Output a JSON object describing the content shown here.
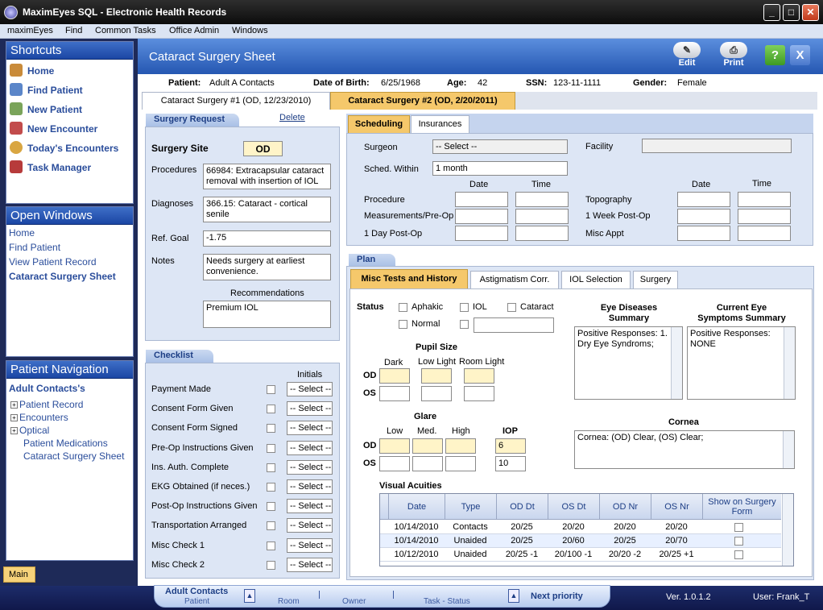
{
  "window": {
    "title": "MaximEyes SQL - Electronic Health Records"
  },
  "menu": [
    "maximEyes",
    "Find",
    "Common Tasks",
    "Office Admin",
    "Windows"
  ],
  "shortcuts": {
    "title": "Shortcuts",
    "items": [
      {
        "label": "Home",
        "icon": "home-icon"
      },
      {
        "label": "Find Patient",
        "icon": "find-patient-icon"
      },
      {
        "label": "New Patient",
        "icon": "new-patient-icon"
      },
      {
        "label": "New Encounter",
        "icon": "new-encounter-icon"
      },
      {
        "label": "Today's Encounters",
        "icon": "clock-icon"
      },
      {
        "label": "Task Manager",
        "icon": "task-icon"
      }
    ]
  },
  "open_windows": {
    "title": "Open Windows",
    "items": [
      "Home",
      "Find Patient",
      "View Patient Record",
      "Cataract Surgery Sheet"
    ]
  },
  "patient_nav": {
    "title": "Patient Navigation",
    "patient": "Adult Contacts's",
    "items": [
      "Patient Record",
      "Encounters",
      "Optical",
      "Patient Medications",
      "Cataract Surgery Sheet"
    ]
  },
  "main_tab": "Main",
  "header": {
    "title": "Cataract Surgery Sheet",
    "edit": "Edit",
    "print": "Print",
    "help": "?",
    "close": "X"
  },
  "patient": {
    "patient_label": "Patient:",
    "patient": "Adult A Contacts",
    "dob_label": "Date of Birth:",
    "dob": "6/25/1968",
    "age_label": "Age:",
    "age": "42",
    "ssn_label": "SSN:",
    "ssn": "123-11-1111",
    "gender_label": "Gender:",
    "gender": "Female"
  },
  "surgery_tabs": [
    "Cataract Surgery #1 (OD, 12/23/2010)",
    "Cataract Surgery #2 (OD, 2/20/2011)"
  ],
  "request": {
    "title": "Surgery Request",
    "delete": "Delete",
    "site_label": "Surgery Site",
    "site": "OD",
    "procedures_label": "Procedures",
    "procedures": "66984: Extracapsular cataract removal with insertion of IOL",
    "diagnoses_label": "Diagnoses",
    "diagnoses": "366.15: Cataract - cortical senile",
    "refgoal_label": "Ref. Goal",
    "refgoal": "-1.75",
    "notes_label": "Notes",
    "notes": "Needs surgery at earliest convenience.",
    "rec_label": "Recommendations",
    "rec": "Premium IOL"
  },
  "checklist": {
    "title": "Checklist",
    "initials": "Initials",
    "select": "-- Select --",
    "items": [
      "Payment Made",
      "Consent Form Given",
      "Consent Form Signed",
      "Pre-Op Instructions Given",
      "Ins. Auth. Complete",
      "EKG Obtained (if neces.)",
      "Post-Op Instructions Given",
      "Transportation Arranged",
      "Misc Check 1",
      "Misc Check 2"
    ]
  },
  "sched_tabs": [
    "Scheduling",
    "Insurances"
  ],
  "sched": {
    "surgeon_label": "Surgeon",
    "surgeon": "-- Select --",
    "facility_label": "Facility",
    "within_label": "Sched. Within",
    "within": "1 month",
    "date": "Date",
    "time": "Time",
    "procedure": "Procedure",
    "measure": "Measurements/Pre-Op",
    "day1": "1 Day Post-Op",
    "topo": "Topography",
    "week1": "1 Week Post-Op",
    "misc": "Misc Appt"
  },
  "plan": {
    "title": "Plan",
    "tabs": [
      "Misc Tests and History",
      "Astigmatism Corr.",
      "IOL Selection",
      "Surgery"
    ],
    "status_label": "Status",
    "aphakic": "Aphakic",
    "iol": "IOL",
    "cataract": "Cataract",
    "normal": "Normal",
    "pupil_title": "Pupil Size",
    "dark": "Dark",
    "low": "Low Light",
    "room": "Room Light",
    "od": "OD",
    "os": "OS",
    "glare_title": "Glare",
    "g_low": "Low",
    "g_med": "Med.",
    "g_high": "High",
    "iop": "IOP",
    "iop_od": "6",
    "iop_os": "10",
    "eye_dis_title": "Eye Diseases Summary",
    "eye_dis": "Positive Responses:  1. Dry Eye Syndroms;",
    "symp_title": "Current Eye Symptoms Summary",
    "symp": "Positive Responses:  NONE",
    "cornea_title": "Cornea",
    "cornea": "Cornea: (OD) Clear, (OS) Clear;",
    "va_title": "Visual Acuities",
    "va_headers": [
      "Date",
      "Type",
      "OD Dt",
      "OS Dt",
      "OD Nr",
      "OS Nr",
      "Show on Surgery Form"
    ],
    "va_rows": [
      [
        "10/14/2010",
        "Contacts",
        "20/25",
        "20/20",
        "20/20",
        "20/20"
      ],
      [
        "10/14/2010",
        "Unaided",
        "20/25",
        "20/60",
        "20/25",
        "20/70"
      ],
      [
        "10/12/2010",
        "Unaided",
        "20/25 -1",
        "20/100 -1",
        "20/20 -2",
        "20/25 +1"
      ]
    ]
  },
  "status": {
    "patient_name": "Adult Contacts",
    "patient": "Patient",
    "room": "Room",
    "owner": "Owner",
    "task": "Task - Status",
    "next": "Next priority",
    "version": "Ver. 1.0.1.2",
    "user": "User: Frank_T"
  }
}
